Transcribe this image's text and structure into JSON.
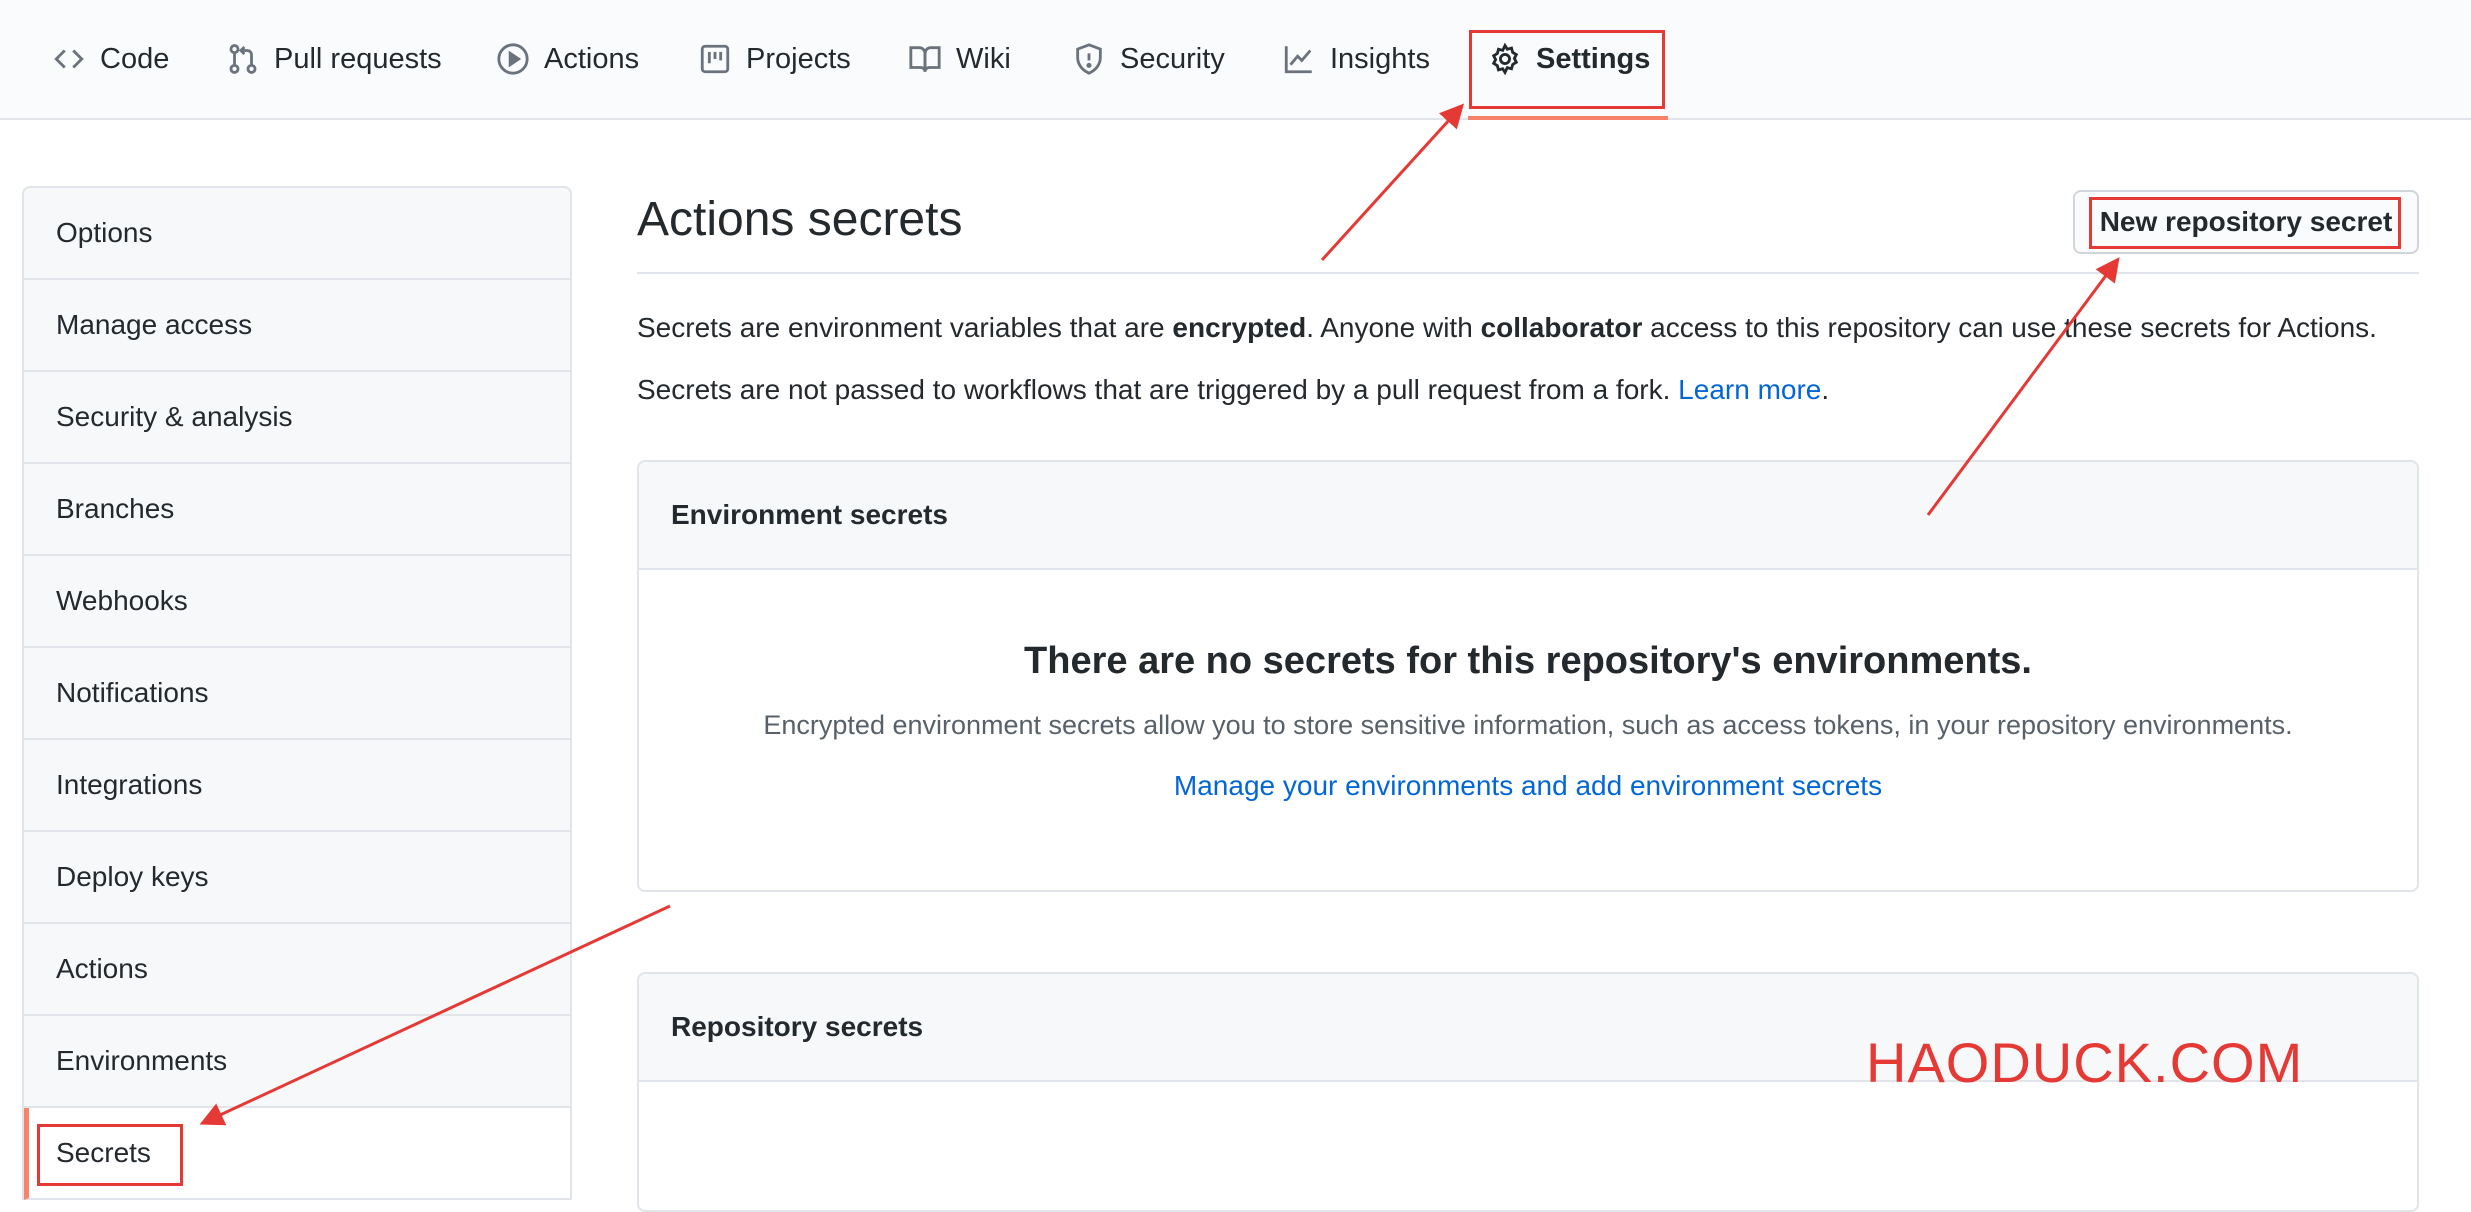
{
  "tabs": [
    {
      "label": "Code",
      "icon": "code-icon"
    },
    {
      "label": "Pull requests",
      "icon": "pull-request-icon"
    },
    {
      "label": "Actions",
      "icon": "play-icon"
    },
    {
      "label": "Projects",
      "icon": "project-icon"
    },
    {
      "label": "Wiki",
      "icon": "book-icon"
    },
    {
      "label": "Security",
      "icon": "shield-icon"
    },
    {
      "label": "Insights",
      "icon": "graph-icon"
    },
    {
      "label": "Settings",
      "icon": "gear-icon",
      "active": true
    }
  ],
  "sidebar": {
    "items": [
      {
        "label": "Options"
      },
      {
        "label": "Manage access"
      },
      {
        "label": "Security & analysis"
      },
      {
        "label": "Branches"
      },
      {
        "label": "Webhooks"
      },
      {
        "label": "Notifications"
      },
      {
        "label": "Integrations"
      },
      {
        "label": "Deploy keys"
      },
      {
        "label": "Actions"
      },
      {
        "label": "Environments"
      },
      {
        "label": "Secrets",
        "selected": true
      }
    ]
  },
  "main": {
    "title": "Actions secrets",
    "new_secret_button": "New repository secret",
    "description1": {
      "part1": "Secrets are environment variables that are ",
      "bold1": "encrypted",
      "part2": ". Anyone with ",
      "bold2": "collaborator",
      "part3": " access to this repository can use these secrets for Actions."
    },
    "description2": {
      "text": "Secrets are not passed to workflows that are triggered by a pull request from a fork. ",
      "link": "Learn more",
      "suffix": "."
    },
    "environment_secrets": {
      "header": "Environment secrets",
      "empty_title": "There are no secrets for this repository's environments.",
      "empty_text": "Encrypted environment secrets allow you to store sensitive information, such as access tokens, in your repository environments.",
      "link": "Manage your environments and add environment secrets"
    },
    "repository_secrets": {
      "header": "Repository secrets"
    }
  },
  "watermark": "HAODUCK.COM",
  "colors": {
    "accent": "#f9826c",
    "link": "#0366d6",
    "annotation": "#e53935"
  }
}
